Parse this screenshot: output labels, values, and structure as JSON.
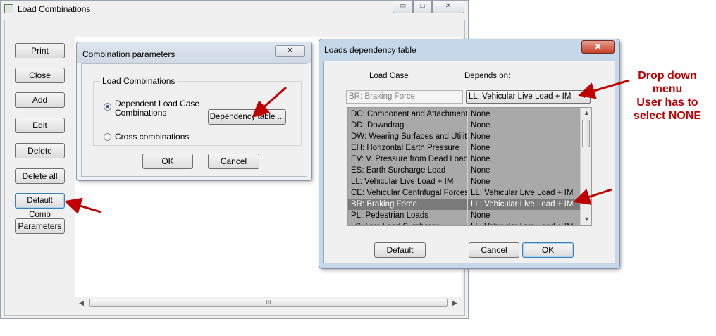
{
  "main_window": {
    "title": "Load Combinations",
    "controls": [
      "▭",
      "□",
      "✕"
    ],
    "buttons": [
      "Print",
      "Close",
      "Add",
      "Edit",
      "Delete",
      "Delete all",
      "Default Comb",
      "Parameters"
    ],
    "scroll_grip": "III"
  },
  "combination_dialog": {
    "title": "Combination parameters",
    "close_glyph": "✕",
    "group_label": "Load Combinations",
    "radio_dependent": "Dependent Load Case\nCombinations",
    "radio_cross": "Cross combinations",
    "dependency_button": "Dependency table ...",
    "ok": "OK",
    "cancel": "Cancel"
  },
  "dependency_dialog": {
    "title": "Loads dependency table",
    "close_glyph": "✕",
    "col_load_case": "Load Case",
    "col_depends_on": "Depends on:",
    "selected_case": "BR: Braking Force",
    "dropdown_value": "LL: Vehicular Live Load + IM",
    "rows": [
      {
        "case": "DC: Component and Attachments",
        "depends": "None"
      },
      {
        "case": "DD: Downdrag",
        "depends": "None"
      },
      {
        "case": "DW: Wearing Surfaces and Utilities",
        "depends": "None"
      },
      {
        "case": "EH: Horizontal Earth Pressure",
        "depends": "None"
      },
      {
        "case": "EV: V. Pressure from Dead Load of",
        "depends": "None"
      },
      {
        "case": "ES: Earth Surcharge Load",
        "depends": "None"
      },
      {
        "case": "LL: Vehicular Live Load + IM",
        "depends": "None"
      },
      {
        "case": "CE: Vehicular Centrifugal Forces",
        "depends": "LL: Vehicular Live Load + IM"
      },
      {
        "case": "BR: Braking Force",
        "depends": "LL: Vehicular Live Load + IM"
      },
      {
        "case": "PL: Pedestrian Loads",
        "depends": "None"
      },
      {
        "case": "LS: Live Load Surcharge",
        "depends": "LL: Vehicular Live Load + IM"
      }
    ],
    "default_button": "Default",
    "cancel_button": "Cancel",
    "ok_button": "OK"
  },
  "annotation": {
    "line1": "Drop down",
    "line2": "menu",
    "line3": "User has to",
    "line4": "select NONE",
    "color": "#c00000"
  }
}
